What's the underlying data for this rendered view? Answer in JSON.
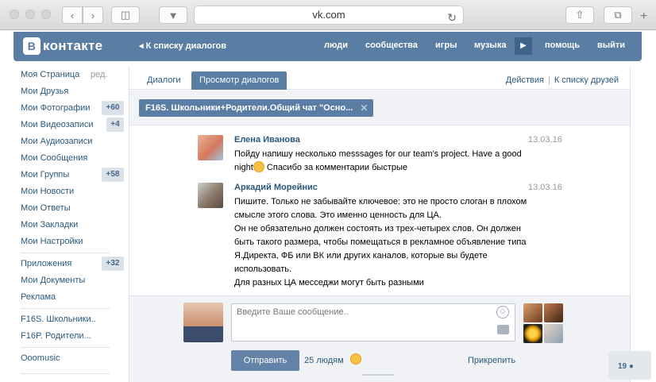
{
  "browser": {
    "url": "vk.com",
    "back_icon": "chevron-left-icon",
    "forward_icon": "chevron-right-icon",
    "sidebar_icon": "sidebar-icon",
    "pocket_icon": "pocket-icon",
    "share_icon": "share-icon",
    "tabs_icon": "tabs-icon",
    "reload_icon": "reload-icon",
    "newtab": "+"
  },
  "header": {
    "logo_b": "В",
    "logo_text": "контакте",
    "back_link": "К списку диалогов",
    "nav": [
      "люди",
      "сообщества",
      "игры",
      "музыка",
      "помощь",
      "выйти"
    ]
  },
  "sidebar": {
    "edit_label": "ред.",
    "items": [
      {
        "label": "Моя Страница",
        "badge": ""
      },
      {
        "label": "Мои Друзья",
        "badge": ""
      },
      {
        "label": "Мои Фотографии",
        "badge": "+60"
      },
      {
        "label": "Мои Видеозаписи",
        "badge": "+4"
      },
      {
        "label": "Мои Аудиозаписи",
        "badge": ""
      },
      {
        "label": "Мои Сообщения",
        "badge": ""
      },
      {
        "label": "Мои Группы",
        "badge": "+58"
      },
      {
        "label": "Мои Новости",
        "badge": ""
      },
      {
        "label": "Мои Ответы",
        "badge": ""
      },
      {
        "label": "Мои Закладки",
        "badge": ""
      },
      {
        "label": "Мои Настройки",
        "badge": ""
      },
      {
        "label": "Приложения",
        "badge": "+32"
      },
      {
        "label": "Мои Документы",
        "badge": ""
      },
      {
        "label": "Реклама",
        "badge": ""
      },
      {
        "label": "F16S. Школьники..",
        "badge": ""
      },
      {
        "label": "F16P. Родители...",
        "badge": ""
      },
      {
        "label": "Ooomusic",
        "badge": ""
      }
    ]
  },
  "tabs": {
    "dialogs": "Диалоги",
    "view": "Просмотр диалогов",
    "actions": "Действия",
    "friends": "К списку друзей"
  },
  "chat": {
    "title": "F16S. Школьники+Родители.Общий чат \"Осно...",
    "close": "✕"
  },
  "messages": [
    {
      "author": "Елена Иванова",
      "date": "13.03.16",
      "text_a": "Пойду напишу несколько messsages for our team's project. Have a good night",
      "text_b": " Спасибо за комментарии быстрые"
    },
    {
      "author": "Аркадий Морейнис",
      "date": "13.03.16",
      "lines": [
        "Пишите. Только не забывайте ключевое: это не просто слоган в плохом смысле этого слова. Это именно ценность для ЦА.",
        "Он не обязательно должен состоять из трех-четырех слов. Он должен быть такого размера, чтобы помещаться в рекламное объявление типа Я.Директа, ФБ или ВК или других каналов, которые вы будете использовать.",
        "Для разных ЦА месседжи могут быть разными"
      ]
    }
  ],
  "composer": {
    "placeholder": "Введите Ваше сообщение..",
    "send": "Отправить",
    "recipients": "25 людям",
    "attach": "Прикрепить"
  },
  "online_count": "19",
  "colors": {
    "brand": "#597da3",
    "link": "#2b587a",
    "badge_bg": "#dae2e8"
  }
}
